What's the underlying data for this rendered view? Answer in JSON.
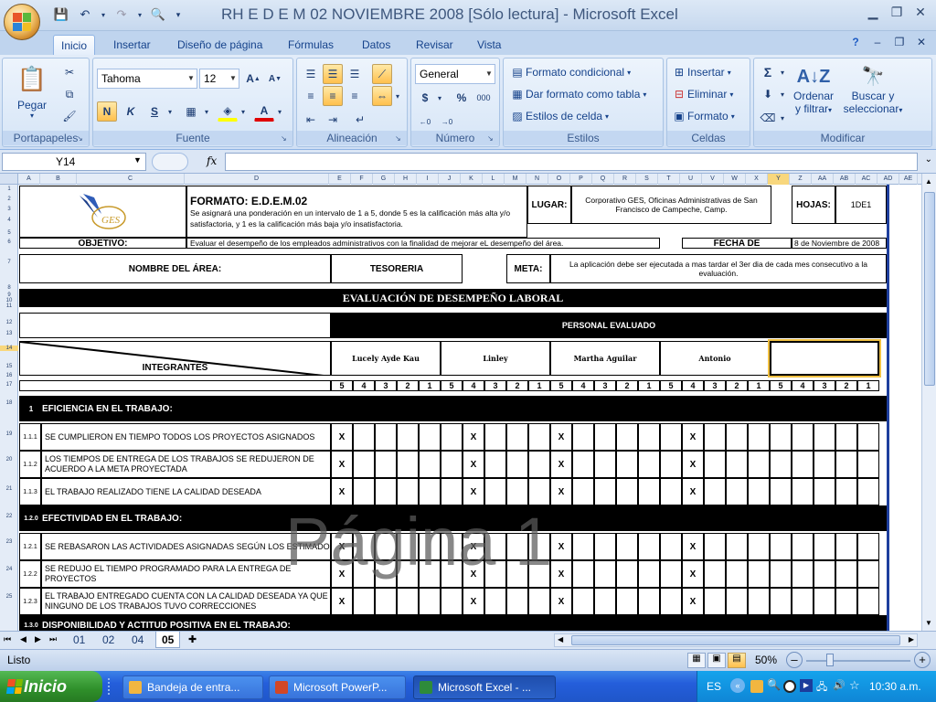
{
  "window": {
    "title": "RH E D E M 02 NOVIEMBRE 2008  [Sólo lectura]  -  Microsoft Excel"
  },
  "ribbon": {
    "tabs": [
      "Inicio",
      "Insertar",
      "Diseño de página",
      "Fórmulas",
      "Datos",
      "Revisar",
      "Vista"
    ],
    "portapapeles": {
      "label": "Portapapeles",
      "paste": "Pegar"
    },
    "fuente": {
      "label": "Fuente",
      "font": "Tahoma",
      "size": "12",
      "bold": "N",
      "italic": "K",
      "underline": "S"
    },
    "alineacion": {
      "label": "Alineación"
    },
    "numero": {
      "label": "Número",
      "format": "General",
      "currency": "$",
      "percent": "%",
      "thousands": "000"
    },
    "estilos": {
      "label": "Estilos",
      "conditional": "Formato condicional",
      "table": "Dar formato como tabla",
      "cell": "Estilos de celda"
    },
    "celdas": {
      "label": "Celdas",
      "insert": "Insertar",
      "delete": "Eliminar",
      "format": "Formato"
    },
    "modificar": {
      "label": "Modificar",
      "sort": "Ordenar",
      "sort2": "y filtrar",
      "find": "Buscar y",
      "find2": "seleccionar",
      "sum": "Σ"
    }
  },
  "formula_bar": {
    "name_box": "Y14",
    "fx": "fx"
  },
  "columns": [
    "A",
    "B",
    "C",
    "D",
    "E",
    "F",
    "G",
    "H",
    "I",
    "J",
    "K",
    "L",
    "M",
    "N",
    "O",
    "P",
    "Q",
    "R",
    "S",
    "T",
    "U",
    "V",
    "W",
    "X",
    "Y",
    "Z",
    "AA",
    "AB",
    "AC",
    "AD",
    "AE"
  ],
  "rows": [
    "1",
    "2",
    "3",
    "4",
    "5",
    "6",
    "7",
    "8",
    "9",
    "10",
    "11",
    "12",
    "13",
    "14",
    "15",
    "16",
    "17",
    "18",
    "19",
    "20",
    "21",
    "22",
    "23",
    "24",
    "25"
  ],
  "sheet": {
    "format_title": "FORMATO: E.D.E.M.02",
    "format_desc": "Se asignará una ponderación en un intervalo de 1 a 5, donde 5 es la calificación más alta y/o satisfactoria, y 1 es la calificación más baja y/o insatisfactoria.",
    "lugar_label": "LUGAR:",
    "lugar_value": "Corporativo GES, Oficinas Administrativas de San Francisco de Campeche, Camp.",
    "hojas_label": "HOJAS:",
    "hojas_value": "1DE1",
    "objetivo_label": "OBJETIVO:",
    "objetivo_value": "Evaluar el desempeño de los empleados administrativos con la finalidad de mejorar eL desempeño del área.",
    "fecha_label": "FECHA DE",
    "fecha_value": "8 de Noviembre de 2008",
    "area_label": "NOMBRE DEL ÁREA:",
    "area_value": "TESORERIA",
    "meta_label": "META:",
    "meta_value": "La aplicación debe ser ejecutada a mas tardar el 3er dia de cada mes consecutivo a la evaluación.",
    "eval_title": "EVALUACIÓN DE DESEMPEÑO LABORAL",
    "personal": "PERSONAL EVALUADO",
    "integrantes": "INTEGRANTES",
    "people": [
      "Lucely Ayde Kau",
      "Linley",
      "Martha Aguilar",
      "Antonio",
      ""
    ],
    "scale": [
      "5",
      "4",
      "3",
      "2",
      "1"
    ],
    "section1_num": "1",
    "section1": "EFICIENCIA EN EL TRABAJO:",
    "section2_num": "1.2.0",
    "section2": "EFECTIVIDAD EN EL TRABAJO:",
    "section3_num": "1.3.0",
    "section3": "DISPONIBILIDAD Y ACTITUD POSITIVA EN EL TRABAJO:",
    "items": [
      {
        "num": "1.1.1",
        "text": "SE CUMPLIERON EN TIEMPO TODOS LOS PROYECTOS ASIGNADOS"
      },
      {
        "num": "1.1.2",
        "text": "LOS TIEMPOS DE ENTREGA DE LOS TRABAJOS SE REDUJERON DE ACUERDO A LA META PROYECTADA"
      },
      {
        "num": "1.1.3",
        "text": "EL TRABAJO REALIZADO TIENE LA CALIDAD DESEADA"
      },
      {
        "num": "1.2.1",
        "text": "SE REBASARON LAS ACTIVIDADES ASIGNADAS SEGÚN LOS ESTIMADO"
      },
      {
        "num": "1.2.2",
        "text": "SE REDUJO EL TIEMPO PROGRAMADO PARA LA ENTREGA DE PROYECTOS"
      },
      {
        "num": "1.2.3",
        "text": "EL TRABAJO ENTREGADO CUENTA CON LA CALIDAD DESEADA YA QUE NINGUNO DE LOS TRABAJOS TUVO CORRECCIONES"
      }
    ],
    "mark": "X",
    "watermark": "Página 1"
  },
  "sheet_tabs": [
    "01",
    "02",
    "04",
    "05"
  ],
  "status": {
    "ready": "Listo",
    "zoom": "50%"
  },
  "taskbar": {
    "start": "Inicio",
    "tasks": [
      "Bandeja de entra...",
      "Microsoft PowerP...",
      "Microsoft Excel - ..."
    ],
    "lang": "ES",
    "clock": "10:30 a.m."
  },
  "colors": {
    "accent": "#15428b",
    "selection": "#f8d77d",
    "task_active": "#1f4fae"
  }
}
